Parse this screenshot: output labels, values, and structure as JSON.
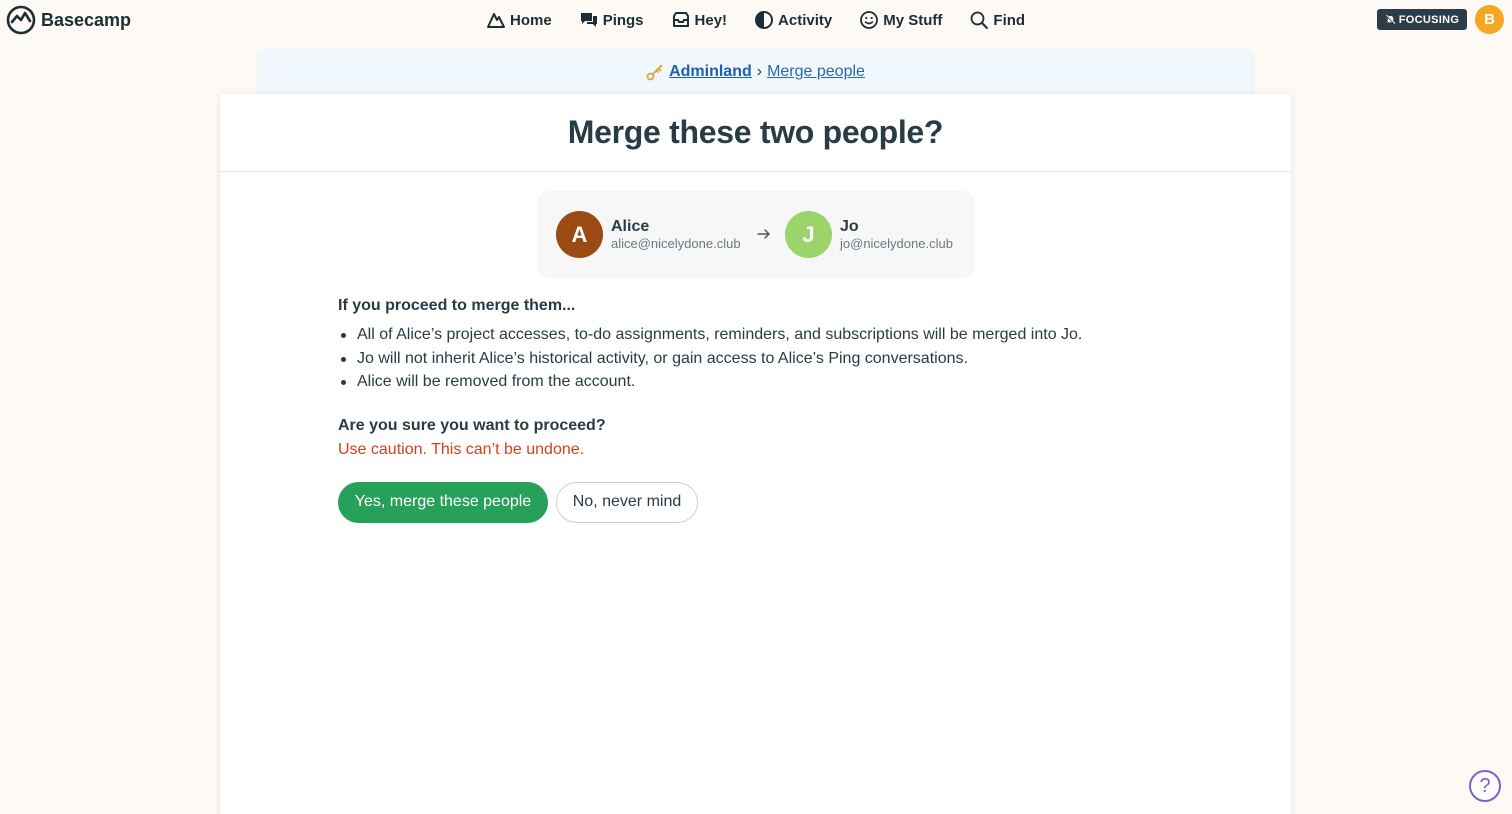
{
  "app": {
    "name": "Basecamp"
  },
  "nav": {
    "items": [
      {
        "label": "Home",
        "icon": "mountain-icon"
      },
      {
        "label": "Pings",
        "icon": "chat-bubbles-icon"
      },
      {
        "label": "Hey!",
        "icon": "inbox-icon"
      },
      {
        "label": "Activity",
        "icon": "half-moon-icon"
      },
      {
        "label": "My Stuff",
        "icon": "smiley-icon"
      },
      {
        "label": "Find",
        "icon": "magnifier-icon"
      }
    ],
    "focus_badge": "FOCUSING",
    "user_initial": "B"
  },
  "breadcrumb": {
    "root": "Adminland",
    "separator": "›",
    "current": "Merge people"
  },
  "page": {
    "title": "Merge these two people?"
  },
  "merge": {
    "from": {
      "initial": "A",
      "name": "Alice",
      "email": "alice@nicelydone.club",
      "color": "#9a4a12"
    },
    "to": {
      "initial": "J",
      "name": "Jo",
      "email": "jo@nicelydone.club",
      "color": "#9bd46a"
    }
  },
  "details": {
    "heading": "If you proceed to merge them...",
    "bullets": [
      "All of Alice’s project accesses, to-do assignments, reminders, and subscriptions will be merged into Jo.",
      "Jo will not inherit Alice’s historical activity, or gain access to Alice’s Ping conversations.",
      "Alice will be removed from the account."
    ],
    "confirm_question": "Are you sure you want to proceed?",
    "caution": "Use caution. This can’t be undone."
  },
  "actions": {
    "confirm_label": "Yes, merge these people",
    "cancel_label": "No, never mind"
  },
  "help": {
    "label": "?"
  },
  "colors": {
    "primary": "#27a05a",
    "caution": "#d43f1e",
    "link": "#2867b2",
    "accent": "#f5a623"
  }
}
